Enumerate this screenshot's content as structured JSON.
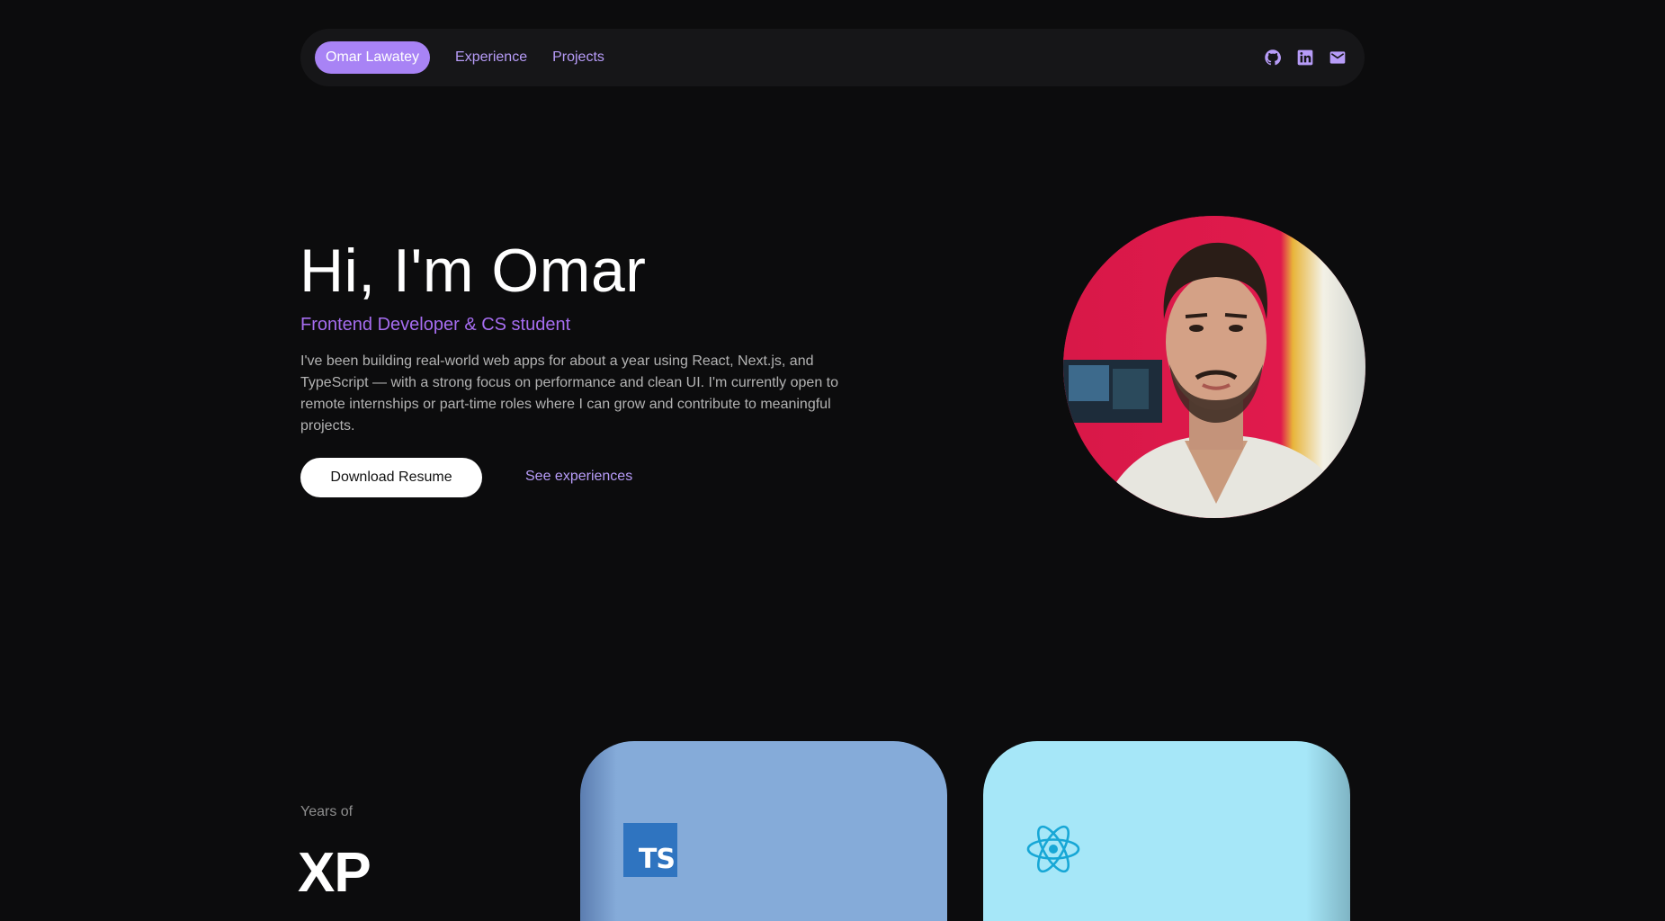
{
  "nav": {
    "brand": "Omar Lawatey",
    "links": [
      {
        "label": "Experience"
      },
      {
        "label": "Projects"
      }
    ],
    "icons": [
      "github-icon",
      "linkedin-icon",
      "mail-icon"
    ],
    "accent_color": "#a883f5"
  },
  "hero": {
    "title": "Hi, I'm Omar",
    "subtitle": "Frontend Developer & CS student",
    "description": "I've been building real-world web apps for about a year using React, Next.js, and TypeScript — with a strong focus on performance and clean UI. I'm currently open to remote internships or part-time roles where I can grow and contribute to meaningful projects.",
    "primary_button": "Download Resume",
    "secondary_link": "See experiences",
    "subtitle_color": "#a66df0"
  },
  "skills": {
    "years_label": "Years of",
    "xp_label": "XP",
    "cards": [
      {
        "logo_text": "TS",
        "icon": "typescript-icon",
        "color": "#85abd9"
      },
      {
        "icon": "react-icon",
        "color": "#a6e7f8"
      }
    ]
  }
}
